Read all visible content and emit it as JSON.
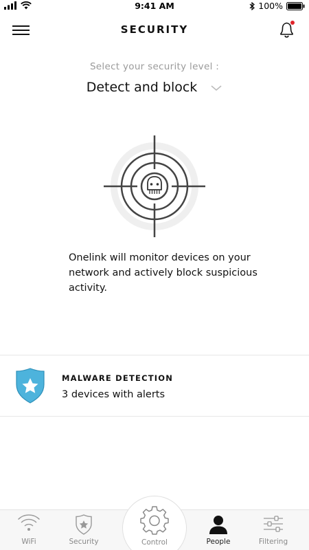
{
  "status_bar": {
    "time": "9:41 AM",
    "battery": "100%",
    "icons": [
      "signal-icon",
      "wifi-icon",
      "bluetooth-icon",
      "battery-icon"
    ]
  },
  "header": {
    "title": "SECURITY",
    "menu_icon": "hamburger-icon",
    "notification_icon": "bell-icon",
    "notification_dot_color": "#e0242b"
  },
  "security_level": {
    "prompt": "Select your security level :",
    "selected": "Detect and block"
  },
  "illustration": {
    "icon": "target-crosshair-skull-icon"
  },
  "description": "Onelink will monitor devices on your network and actively block suspicious activity.",
  "malware": {
    "title": "MALWARE DETECTION",
    "subtitle": "3 devices with alerts",
    "icon": "shield-star-icon",
    "icon_color": "#4db3dc"
  },
  "bottom_nav": {
    "items": [
      {
        "label": "WiFi",
        "icon": "wifi-icon"
      },
      {
        "label": "Security",
        "icon": "shield-star-icon"
      },
      {
        "label": "Control",
        "icon": "gear-icon"
      },
      {
        "label": "People",
        "icon": "person-icon"
      },
      {
        "label": "Filtering",
        "icon": "sliders-icon"
      }
    ],
    "active": "People"
  }
}
